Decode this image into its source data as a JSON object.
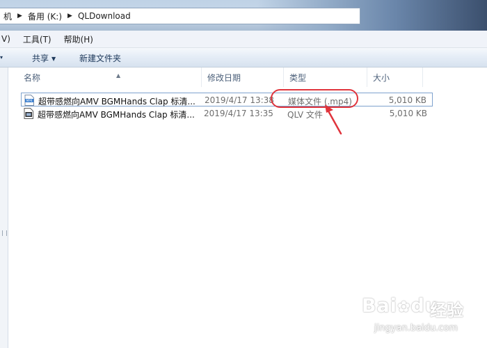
{
  "address_bar": {
    "path": [
      "机",
      "备用 (K:)",
      "QLDownload"
    ]
  },
  "menu": {
    "items": [
      "V)",
      "工具(T)",
      "帮助(H)"
    ]
  },
  "command_bar": {
    "organize_caret": "▾",
    "share_label": "共享",
    "new_folder_label": "新建文件夹"
  },
  "columns": {
    "name": "名称",
    "date": "修改日期",
    "type": "类型",
    "size": "大小"
  },
  "files": [
    {
      "name": "超带感燃向AMV BGMHands Clap 标清...",
      "date": "2019/4/17 13:38",
      "type": "媒体文件 (.mp4)",
      "size": "5,010 KB",
      "icon": "mp4-file-icon",
      "selected": true
    },
    {
      "name": "超带感燃向AMV BGMHands Clap 标清...",
      "date": "2019/4/17 13:35",
      "type": "QLV 文件",
      "size": "5,010 KB",
      "icon": "qlv-file-icon",
      "selected": false
    }
  ],
  "colors": {
    "annotation": "#e0343c",
    "selection_border": "#7da2ce",
    "header_text": "#4c607a"
  },
  "watermark": {
    "brand": "Bai",
    "paw": "du",
    "suffix": "经验",
    "url": "jingyan.baidu.com"
  }
}
